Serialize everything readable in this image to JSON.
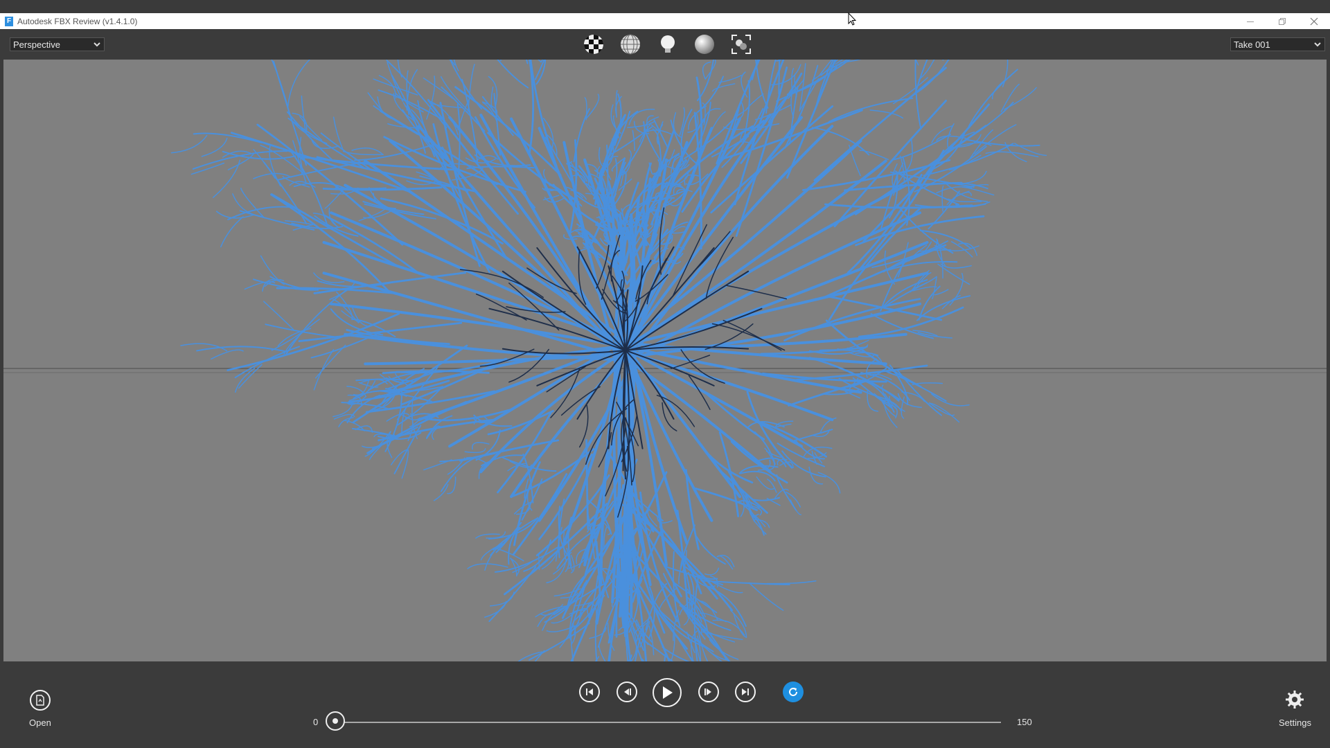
{
  "window": {
    "title": "Autodesk FBX Review (v1.4.1.0)",
    "app_icon_letter": "F",
    "controls": [
      "minimize-icon",
      "restore-icon",
      "close-icon"
    ]
  },
  "toolbar": {
    "view_select": "Perspective",
    "take_select": "Take 001",
    "mode_buttons": [
      "checker-texture-icon",
      "wireframe-sphere-icon",
      "light-bulb-icon",
      "shaded-sphere-icon",
      "frame-all-icon"
    ]
  },
  "viewport": {
    "background": "#808080",
    "model_color": "#4a90dd",
    "skeleton_color": "#1e2e4a"
  },
  "playback": {
    "buttons": [
      "skip-start-icon",
      "step-back-icon",
      "play-icon",
      "step-forward-icon",
      "skip-end-icon",
      "loop-icon"
    ],
    "loop_color": "#1e8fe0",
    "range_start": "0",
    "range_end": "150",
    "current_frame_fraction": 0
  },
  "footer": {
    "open_label": "Open",
    "settings_label": "Settings"
  }
}
